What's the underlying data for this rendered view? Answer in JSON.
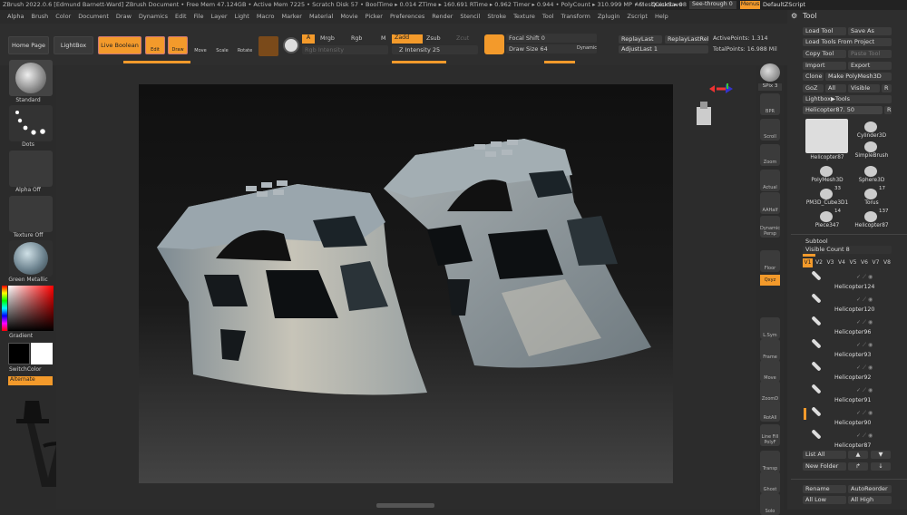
{
  "titlebar": {
    "text": "ZBrush 2022.0.6 [Edmund Barnett-Ward]  ZBrush Document   • Free Mem 47.124GB • Active Mem 7225 • Scratch Disk 57 • BoolTime ▸ 0.014 ZTime ▸ 160.691 RTime ▸ 0.962 Timer ▸ 0.944 • PolyCount ▸ 310.999 MP • MeshCount ▸ 98",
    "ac": "AC",
    "quicksave": "QuickSave",
    "see_through": "See-through  0",
    "menus": "Menus",
    "default_zscript": "DefaultZScript"
  },
  "menu": [
    "Alpha",
    "Brush",
    "Color",
    "Document",
    "Draw",
    "Dynamics",
    "Edit",
    "File",
    "Layer",
    "Light",
    "Macro",
    "Marker",
    "Material",
    "Movie",
    "Picker",
    "Preferences",
    "Render",
    "Stencil",
    "Stroke",
    "Texture",
    "Tool",
    "Transform",
    "Zplugin",
    "Zscript",
    "Help"
  ],
  "toolbar": {
    "home_page": "Home Page",
    "lightbox": "LightBox",
    "live_boolean": "Live Boolean",
    "edit": "Edit",
    "draw": "Draw",
    "move": "Move",
    "scale": "Scale",
    "rotate": "Rotate",
    "a": "A",
    "mrgb": "Mrgb",
    "rgb": "Rgb",
    "m": "M",
    "zadd": "Zadd",
    "zsub": "Zsub",
    "zcut": "Zcut",
    "rgb_intensity": "Rgb Intensity",
    "z_intensity": "Z Intensity 25",
    "focal_shift": "Focal Shift 0",
    "draw_size": "Draw Size 64",
    "dynamic": "Dynamic",
    "replay_last": "ReplayLast",
    "replay_last_rel": "ReplayLastRel",
    "adjust_last": "AdjustLast 1",
    "active_points": "ActivePoints: 1.314",
    "total_points": "TotalPoints: 16.988 Mil"
  },
  "left": {
    "brush_label": "Standard",
    "stroke_label": "Dots",
    "alpha_label": "Alpha Off",
    "texture_label": "Texture Off",
    "material_label": "Green Metallic",
    "gradient_label": "Gradient",
    "switch_color": "SwitchColor",
    "alternate": "Alternate"
  },
  "rightshelf": {
    "spix": "SPix 3",
    "buttons": [
      "BPR",
      "Scroll",
      "Zoom",
      "Actual",
      "AAHalf",
      "Dynamic Persp",
      "Floor",
      "L.Sym",
      "Frame",
      "Move",
      "ZoomD",
      "RotAll",
      "Line Fill PolyF",
      "Transp",
      "Ghost",
      "Solo",
      "Dyn"
    ],
    "xyz": "Qxyz"
  },
  "tool": {
    "header": "Tool",
    "load_tool": "Load Tool",
    "save_as": "Save As",
    "load_from_project": "Load Tools From Project",
    "copy_tool": "Copy Tool",
    "paste_tool": "Paste Tool",
    "import": "Import",
    "export": "Export",
    "clone": "Clone",
    "make_polymesh": "Make PolyMesh3D",
    "goz": "GoZ",
    "all": "All",
    "visible": "Visible",
    "r": "R",
    "lightbox_tools": "Lightbox▶Tools",
    "current_tool": "Helicopter87. 50",
    "tool_r": "R",
    "thumbs": [
      {
        "label": "Helicopter87",
        "count": "137"
      },
      {
        "label": "Cylinder3D",
        "count": ""
      },
      {
        "label": "SimpleBrush",
        "count": ""
      },
      {
        "label": "PolyMesh3D",
        "count": ""
      },
      {
        "label": "Sphere3D",
        "count": ""
      },
      {
        "label": "PM3D_Cube3D1",
        "count": "33"
      },
      {
        "label": "Torus",
        "count": "17"
      },
      {
        "label": "Piece347",
        "count": "14"
      },
      {
        "label": "Helicopter87",
        "count": "137"
      }
    ]
  },
  "subtool": {
    "header": "Subtool",
    "visible_count": "Visible Count 8",
    "versions": [
      "V1",
      "V2",
      "V3",
      "V4",
      "V5",
      "V6",
      "V7",
      "V8"
    ],
    "items": [
      "Helicopter124",
      "Helicopter120",
      "Helicopter96",
      "Helicopter93",
      "Helicopter92",
      "Helicopter91",
      "Helicopter90",
      "Helicopter87"
    ],
    "list_all": "List All",
    "new_folder": "New Folder",
    "rename": "Rename",
    "auto_reorder": "AutoReorder",
    "all_low": "All Low",
    "all_high": "All High"
  },
  "colors": {
    "accent": "#f39a2b",
    "bg": "#2a2a2a"
  }
}
